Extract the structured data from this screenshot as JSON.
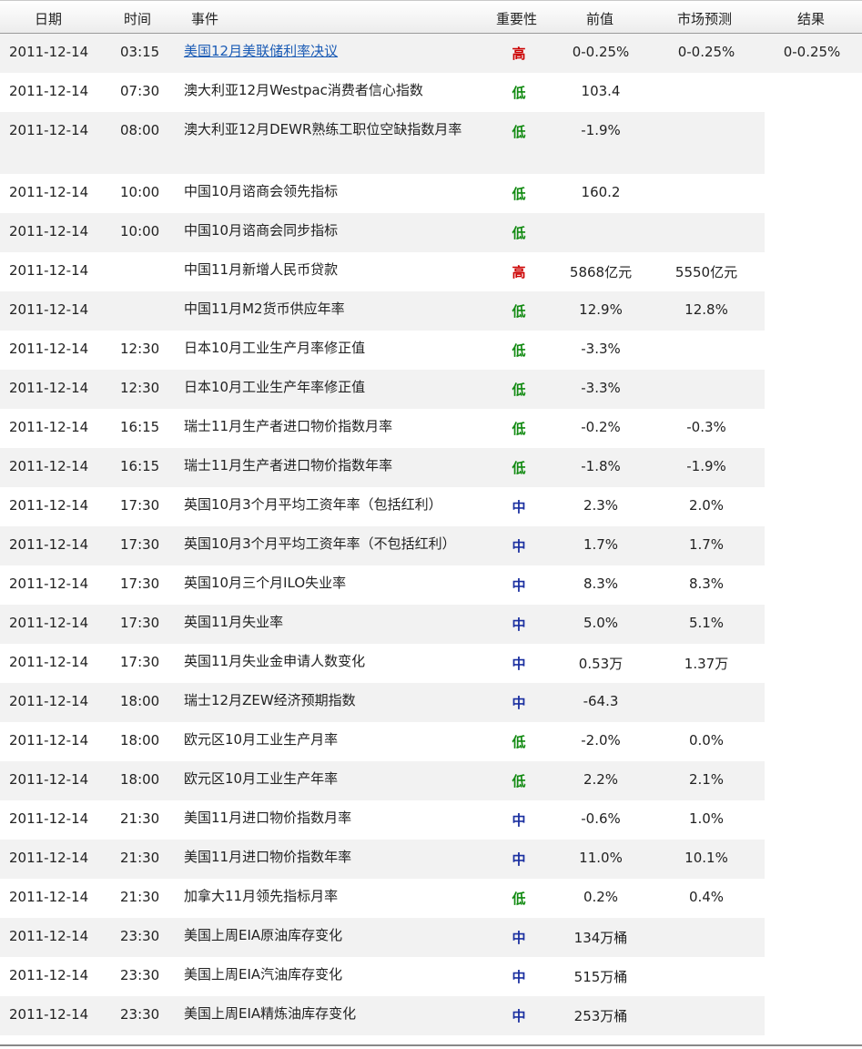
{
  "header": {
    "date": "日期",
    "time": "时间",
    "event": "事件",
    "importance": "重要性",
    "previous": "前值",
    "forecast": "市场预测",
    "result": "结果"
  },
  "colors": {
    "high": "#cc0000",
    "low": "#118a11",
    "mid": "#1a2fa0",
    "link": "#1a5bb5"
  },
  "rows": [
    {
      "date": "2011-12-14",
      "time": "03:15",
      "event": "美国12月美联储利率决议",
      "importance": "高",
      "level": "high",
      "previous": "0-0.25%",
      "forecast": "0-0.25%",
      "result": "0-0.25%",
      "link": true
    },
    {
      "date": "2011-12-14",
      "time": "07:30",
      "event": "澳大利亚12月Westpac消费者信心指数",
      "importance": "低",
      "level": "low",
      "previous": "103.4",
      "forecast": "",
      "result": ""
    },
    {
      "date": "2011-12-14",
      "time": "08:00",
      "event": "澳大利亚12月DEWR熟练工职位空缺指数月率",
      "importance": "低",
      "level": "low",
      "previous": "-1.9%",
      "forecast": "",
      "result": "",
      "tall": true
    },
    {
      "date": "2011-12-14",
      "time": "10:00",
      "event": "中国10月谘商会领先指标",
      "importance": "低",
      "level": "low",
      "previous": "160.2",
      "forecast": "",
      "result": ""
    },
    {
      "date": "2011-12-14",
      "time": "10:00",
      "event": "中国10月谘商会同步指标",
      "importance": "低",
      "level": "low",
      "previous": "",
      "forecast": "",
      "result": ""
    },
    {
      "date": "2011-12-14",
      "time": "",
      "event": "中国11月新增人民币贷款",
      "importance": "高",
      "level": "high",
      "previous": "5868亿元",
      "forecast": "5550亿元",
      "result": ""
    },
    {
      "date": "2011-12-14",
      "time": "",
      "event": "中国11月M2货币供应年率",
      "importance": "低",
      "level": "low",
      "previous": "12.9%",
      "forecast": "12.8%",
      "result": ""
    },
    {
      "date": "2011-12-14",
      "time": "12:30",
      "event": "日本10月工业生产月率修正值",
      "importance": "低",
      "level": "low",
      "previous": "-3.3%",
      "forecast": "",
      "result": ""
    },
    {
      "date": "2011-12-14",
      "time": "12:30",
      "event": "日本10月工业生产年率修正值",
      "importance": "低",
      "level": "low",
      "previous": "-3.3%",
      "forecast": "",
      "result": ""
    },
    {
      "date": "2011-12-14",
      "time": "16:15",
      "event": "瑞士11月生产者进口物价指数月率",
      "importance": "低",
      "level": "low",
      "previous": "-0.2%",
      "forecast": "-0.3%",
      "result": ""
    },
    {
      "date": "2011-12-14",
      "time": "16:15",
      "event": "瑞士11月生产者进口物价指数年率",
      "importance": "低",
      "level": "low",
      "previous": "-1.8%",
      "forecast": "-1.9%",
      "result": ""
    },
    {
      "date": "2011-12-14",
      "time": "17:30",
      "event": "英国10月3个月平均工资年率（包括红利）",
      "importance": "中",
      "level": "mid",
      "previous": "2.3%",
      "forecast": "2.0%",
      "result": ""
    },
    {
      "date": "2011-12-14",
      "time": "17:30",
      "event": "英国10月3个月平均工资年率（不包括红利）",
      "importance": "中",
      "level": "mid",
      "previous": "1.7%",
      "forecast": "1.7%",
      "result": ""
    },
    {
      "date": "2011-12-14",
      "time": "17:30",
      "event": "英国10月三个月ILO失业率",
      "importance": "中",
      "level": "mid",
      "previous": "8.3%",
      "forecast": "8.3%",
      "result": ""
    },
    {
      "date": "2011-12-14",
      "time": "17:30",
      "event": "英国11月失业率",
      "importance": "中",
      "level": "mid",
      "previous": "5.0%",
      "forecast": "5.1%",
      "result": ""
    },
    {
      "date": "2011-12-14",
      "time": "17:30",
      "event": "英国11月失业金申请人数变化",
      "importance": "中",
      "level": "mid",
      "previous": "0.53万",
      "forecast": "1.37万",
      "result": ""
    },
    {
      "date": "2011-12-14",
      "time": "18:00",
      "event": "瑞士12月ZEW经济预期指数",
      "importance": "中",
      "level": "mid",
      "previous": "-64.3",
      "forecast": "",
      "result": ""
    },
    {
      "date": "2011-12-14",
      "time": "18:00",
      "event": "欧元区10月工业生产月率",
      "importance": "低",
      "level": "low",
      "previous": "-2.0%",
      "forecast": "0.0%",
      "result": ""
    },
    {
      "date": "2011-12-14",
      "time": "18:00",
      "event": "欧元区10月工业生产年率",
      "importance": "低",
      "level": "low",
      "previous": "2.2%",
      "forecast": "2.1%",
      "result": ""
    },
    {
      "date": "2011-12-14",
      "time": "21:30",
      "event": "美国11月进口物价指数月率",
      "importance": "中",
      "level": "mid",
      "previous": "-0.6%",
      "forecast": "1.0%",
      "result": ""
    },
    {
      "date": "2011-12-14",
      "time": "21:30",
      "event": "美国11月进口物价指数年率",
      "importance": "中",
      "level": "mid",
      "previous": "11.0%",
      "forecast": "10.1%",
      "result": ""
    },
    {
      "date": "2011-12-14",
      "time": "21:30",
      "event": "加拿大11月领先指标月率",
      "importance": "低",
      "level": "low",
      "previous": "0.2%",
      "forecast": "0.4%",
      "result": ""
    },
    {
      "date": "2011-12-14",
      "time": "23:30",
      "event": "美国上周EIA原油库存变化",
      "importance": "中",
      "level": "mid",
      "previous": "134万桶",
      "forecast": "",
      "result": ""
    },
    {
      "date": "2011-12-14",
      "time": "23:30",
      "event": "美国上周EIA汽油库存变化",
      "importance": "中",
      "level": "mid",
      "previous": "515万桶",
      "forecast": "",
      "result": ""
    },
    {
      "date": "2011-12-14",
      "time": "23:30",
      "event": "美国上周EIA精炼油库存变化",
      "importance": "中",
      "level": "mid",
      "previous": "253万桶",
      "forecast": "",
      "result": ""
    }
  ]
}
